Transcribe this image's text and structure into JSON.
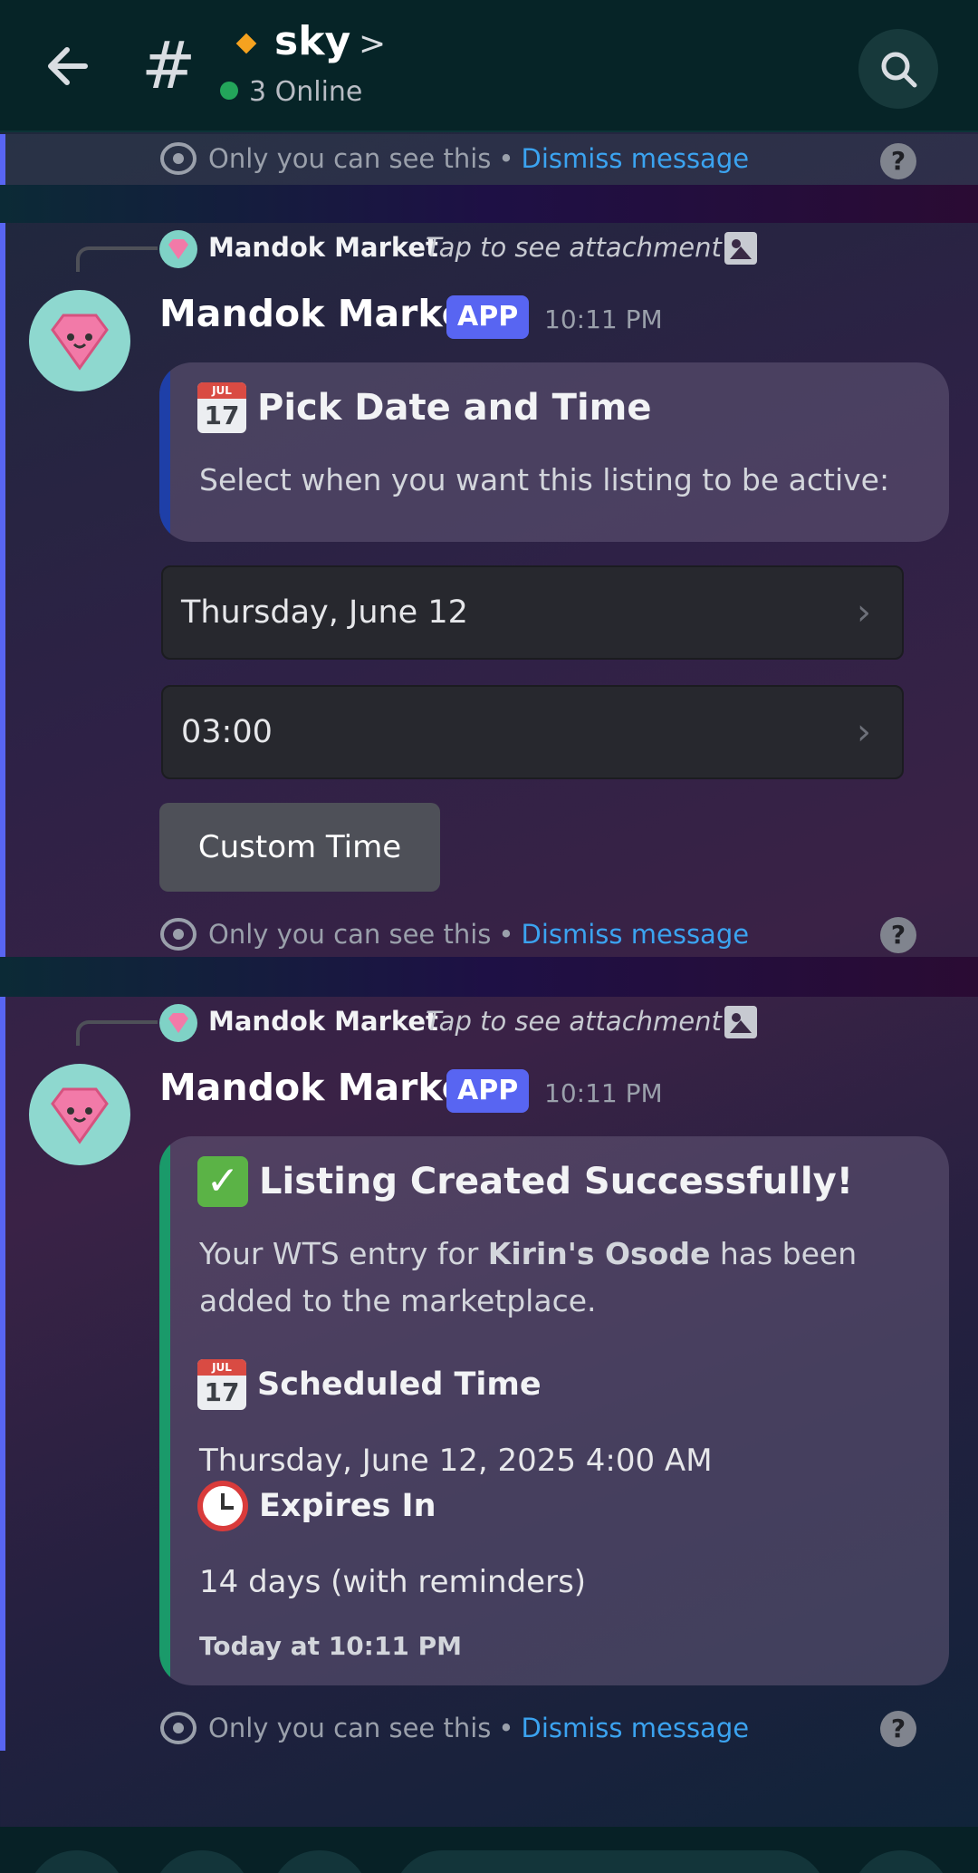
{
  "header": {
    "channel_name": "sky",
    "online_text": "3 Online",
    "hash": "#",
    "chevron": ">"
  },
  "ephemeral": {
    "text": "Only you can see this",
    "separator": "•",
    "dismiss": "Dismiss message",
    "help": "?"
  },
  "messages": [
    {
      "reply_name": "Mandok Market",
      "reply_text": "Tap to see attachment",
      "author": "Mandok Market",
      "badge": "APP",
      "time": "10:11 PM",
      "embed": {
        "accent_color": "#1e3fa8",
        "title": "Pick Date and Time",
        "title_icon": "calendar-icon",
        "description": "Select when you want this listing to be active:"
      },
      "selects": [
        {
          "value": "Thursday, June 12"
        },
        {
          "value": "03:00"
        }
      ],
      "button": "Custom Time"
    },
    {
      "reply_name": "Mandok Market",
      "reply_text": "Tap to see attachment",
      "author": "Mandok Market",
      "badge": "APP",
      "time": "10:11 PM",
      "embed": {
        "accent_color": "#1a9a6a",
        "title": "Listing Created Successfully!",
        "title_icon": "check-icon",
        "desc_prefix": "Your WTS entry for ",
        "desc_bold": "Kirin's Osode",
        "desc_suffix": " has been",
        "desc_line2": "added to the marketplace.",
        "fields": [
          {
            "name": "Scheduled Time",
            "icon": "calendar-icon",
            "value": "Thursday, June 12, 2025 4:00 AM"
          },
          {
            "name": "Expires In",
            "icon": "alarm-clock-icon",
            "value": "14 days (with reminders)"
          }
        ],
        "footer": "Today at 10:11 PM"
      }
    }
  ],
  "calendar_icon": {
    "month": "JUL",
    "day": "17"
  },
  "colors": {
    "header_bg": "#062427",
    "accent": "#5865f2",
    "link": "#3ba3f0",
    "online": "#23a55a"
  }
}
